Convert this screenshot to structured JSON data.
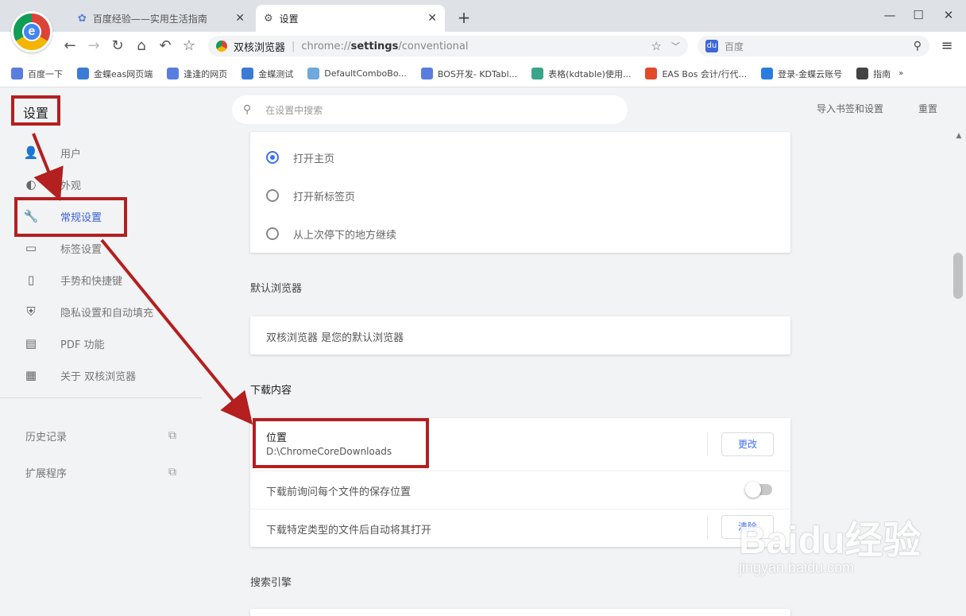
{
  "tabs": [
    {
      "title": "百度经验——实用生活指南",
      "icon": "paw-icon"
    },
    {
      "title": "设置",
      "icon": "gear-icon"
    }
  ],
  "toolbar": {
    "omnibox_site": "双核浏览器",
    "omnibox_url_prefix": "chrome://",
    "omnibox_url_bold": "settings",
    "omnibox_url_suffix": "/conventional",
    "search_placeholder": "百度"
  },
  "bookmarks": [
    {
      "label": "百度一下",
      "color": "#5a7de0"
    },
    {
      "label": "金蝶eas网页端",
      "color": "#3b7bd5"
    },
    {
      "label": "逢逢的网页",
      "color": "#5a7de0"
    },
    {
      "label": "金蝶测试",
      "color": "#3b7bd5"
    },
    {
      "label": "DefaultComboBo...",
      "color": "#6fa8dc"
    },
    {
      "label": "BOS开发- KDTabl...",
      "color": "#5a7de0"
    },
    {
      "label": "表格(kdtable)使用...",
      "color": "#3aa58a"
    },
    {
      "label": "EAS Bos 会计/行代...",
      "color": "#e24a2a"
    },
    {
      "label": "登录-金蝶云账号",
      "color": "#2a7de0"
    },
    {
      "label": "指南",
      "color": "#444444"
    }
  ],
  "header": {
    "title": "设置",
    "search_placeholder": "在设置中搜索",
    "import_link": "导入书签和设置",
    "reset_link": "重置"
  },
  "sidebar": {
    "items": [
      {
        "label": "用户",
        "icon": "person-icon",
        "active": false
      },
      {
        "label": "外观",
        "icon": "palette-icon",
        "active": false
      },
      {
        "label": "常规设置",
        "icon": "wrench-icon",
        "active": true
      },
      {
        "label": "标签设置",
        "icon": "tab-icon",
        "active": false
      },
      {
        "label": "手势和快捷键",
        "icon": "mouse-icon",
        "active": false
      },
      {
        "label": "隐私设置和自动填充",
        "icon": "shield-icon",
        "active": false
      },
      {
        "label": "PDF 功能",
        "icon": "pdf-icon",
        "active": false
      },
      {
        "label": "关于 双核浏览器",
        "icon": "info-icon",
        "active": false
      }
    ],
    "extra": [
      {
        "label": "历史记录"
      },
      {
        "label": "扩展程序"
      }
    ]
  },
  "startup": {
    "options": [
      {
        "label": "打开主页",
        "selected": true
      },
      {
        "label": "打开新标签页",
        "selected": false
      },
      {
        "label": "从上次停下的地方继续",
        "selected": false
      }
    ]
  },
  "default_browser": {
    "title": "默认浏览器",
    "status": "双核浏览器 是您的默认浏览器"
  },
  "downloads": {
    "title": "下载内容",
    "location_label": "位置",
    "location_value": "D:\\ChromeCoreDownloads",
    "change_button": "更改",
    "ask_label": "下载前询问每个文件的保存位置",
    "ask_enabled": false,
    "auto_open_label": "下载特定类型的文件后自动将其打开",
    "clear_button": "清除"
  },
  "search_engine": {
    "title": "搜索引擎"
  },
  "watermark": {
    "brand": "Baidu经验",
    "url": "jingyan.baidu.com"
  },
  "colors": {
    "accent": "#3c6ff0",
    "annotation": "#b41f1f"
  }
}
